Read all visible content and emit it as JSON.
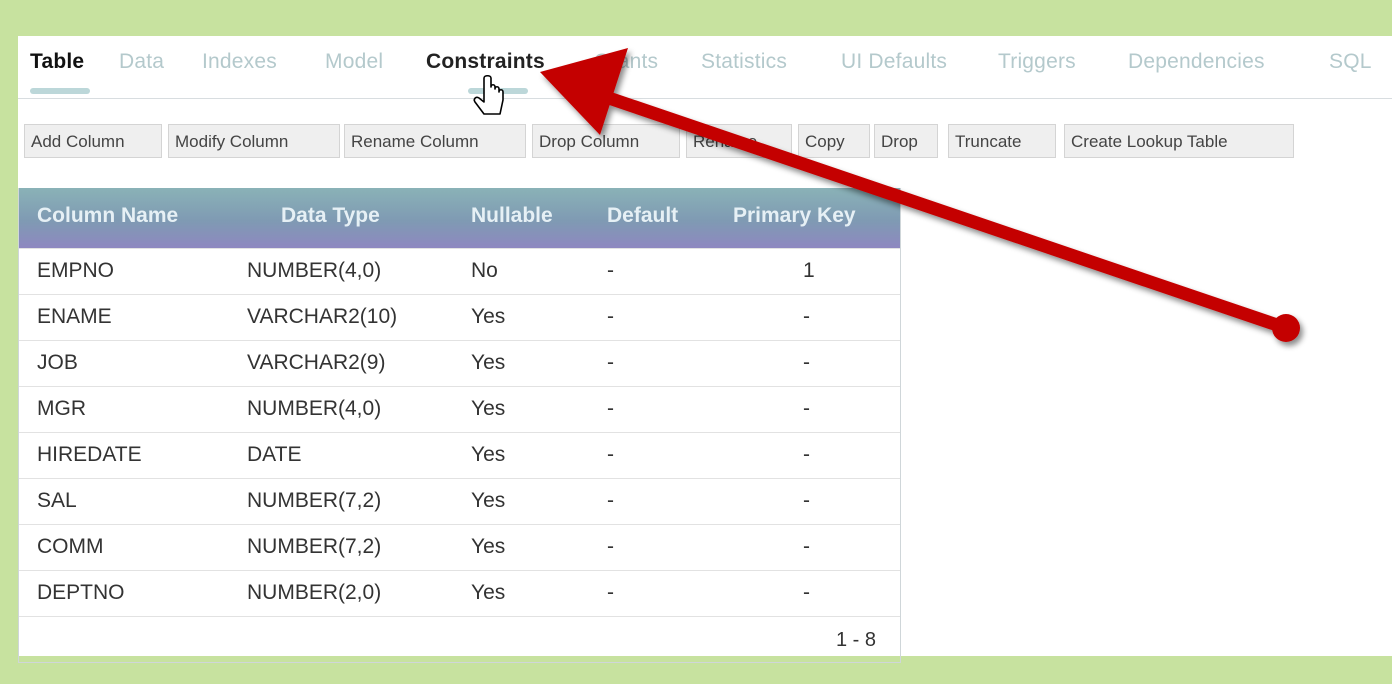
{
  "tabs": [
    {
      "label": "Table"
    },
    {
      "label": "Data"
    },
    {
      "label": "Indexes"
    },
    {
      "label": "Model"
    },
    {
      "label": "Constraints"
    },
    {
      "label": "Grants"
    },
    {
      "label": "Statistics"
    },
    {
      "label": "UI Defaults"
    },
    {
      "label": "Triggers"
    },
    {
      "label": "Dependencies"
    },
    {
      "label": "SQL"
    }
  ],
  "toolbar": {
    "add_column": "Add Column",
    "modify_column": "Modify Column",
    "rename_column": "Rename Column",
    "drop_column": "Drop Column",
    "rename": "Rename",
    "copy": "Copy",
    "drop": "Drop",
    "truncate": "Truncate",
    "create_lookup": "Create Lookup Table"
  },
  "table": {
    "headers": {
      "column_name": "Column Name",
      "data_type": "Data Type",
      "nullable": "Nullable",
      "default": "Default",
      "primary_key": "Primary Key"
    },
    "rows": [
      {
        "name": "EMPNO",
        "type": "NUMBER(4,0)",
        "nullable": "No",
        "default": "-",
        "pk": "1"
      },
      {
        "name": "ENAME",
        "type": "VARCHAR2(10)",
        "nullable": "Yes",
        "default": "-",
        "pk": "-"
      },
      {
        "name": "JOB",
        "type": "VARCHAR2(9)",
        "nullable": "Yes",
        "default": "-",
        "pk": "-"
      },
      {
        "name": "MGR",
        "type": "NUMBER(4,0)",
        "nullable": "Yes",
        "default": "-",
        "pk": "-"
      },
      {
        "name": "HIREDATE",
        "type": "DATE",
        "nullable": "Yes",
        "default": "-",
        "pk": "-"
      },
      {
        "name": "SAL",
        "type": "NUMBER(7,2)",
        "nullable": "Yes",
        "default": "-",
        "pk": "-"
      },
      {
        "name": "COMM",
        "type": "NUMBER(7,2)",
        "nullable": "Yes",
        "default": "-",
        "pk": "-"
      },
      {
        "name": "DEPTNO",
        "type": "NUMBER(2,0)",
        "nullable": "Yes",
        "default": "-",
        "pk": "-"
      }
    ],
    "pagination": "1 - 8"
  },
  "colors": {
    "background": "#c7e29f",
    "arrow": "#c40000",
    "inactive_tab": "#b4c9cc"
  }
}
